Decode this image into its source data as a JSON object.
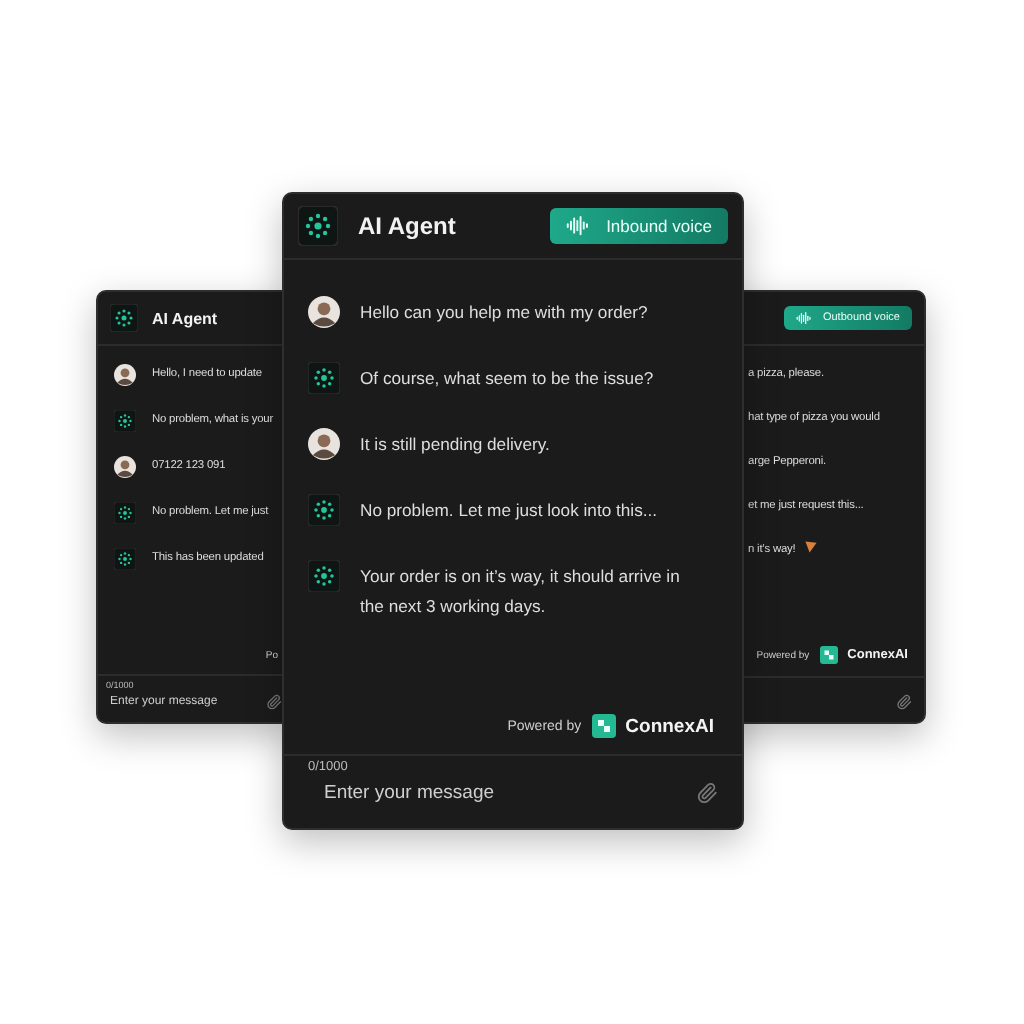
{
  "panels": [
    {
      "kind": "left",
      "title": "AI Agent",
      "messages": [
        {
          "kind": "user",
          "text": "Hello, I need to update"
        },
        {
          "kind": "agent",
          "text": "No problem, what is your"
        },
        {
          "kind": "user",
          "text": "07122 123 091"
        },
        {
          "kind": "agent",
          "text": "No problem. Let me just"
        },
        {
          "kind": "agent",
          "text": "This has been updated"
        }
      ],
      "powered_by": "Po",
      "counter": "0/1000",
      "input": {
        "placeholder": "Enter your message"
      }
    },
    {
      "kind": "right",
      "badge": "Outbound voice",
      "messages": [
        {
          "kind": "plain",
          "text": "a pizza, please."
        },
        {
          "kind": "plain",
          "text": "hat type of pizza you would"
        },
        {
          "kind": "plain",
          "text": "arge Pepperoni."
        },
        {
          "kind": "plain",
          "text": "et me just request this..."
        },
        {
          "kind": "pizza",
          "text": "n it’s way!"
        }
      ],
      "powered_by": "Powered by",
      "brand": "ConnexAI"
    },
    {
      "kind": "front",
      "title": "AI Agent",
      "badge": "Inbound voice",
      "messages": [
        {
          "kind": "user",
          "text": "Hello can you help me with my order?"
        },
        {
          "kind": "agent",
          "text": "Of course, what seem to be the issue?"
        },
        {
          "kind": "user",
          "text": "It is still pending delivery."
        },
        {
          "kind": "agent",
          "text": "No problem. Let me just look into this..."
        },
        {
          "kind": "agent",
          "text": "Your order is on it’s way, it should arrive in the next 3 working days."
        }
      ],
      "powered_by": "Powered by",
      "brand": "ConnexAI",
      "counter": "0/1000",
      "input": {
        "placeholder": "Enter your message"
      }
    }
  ]
}
